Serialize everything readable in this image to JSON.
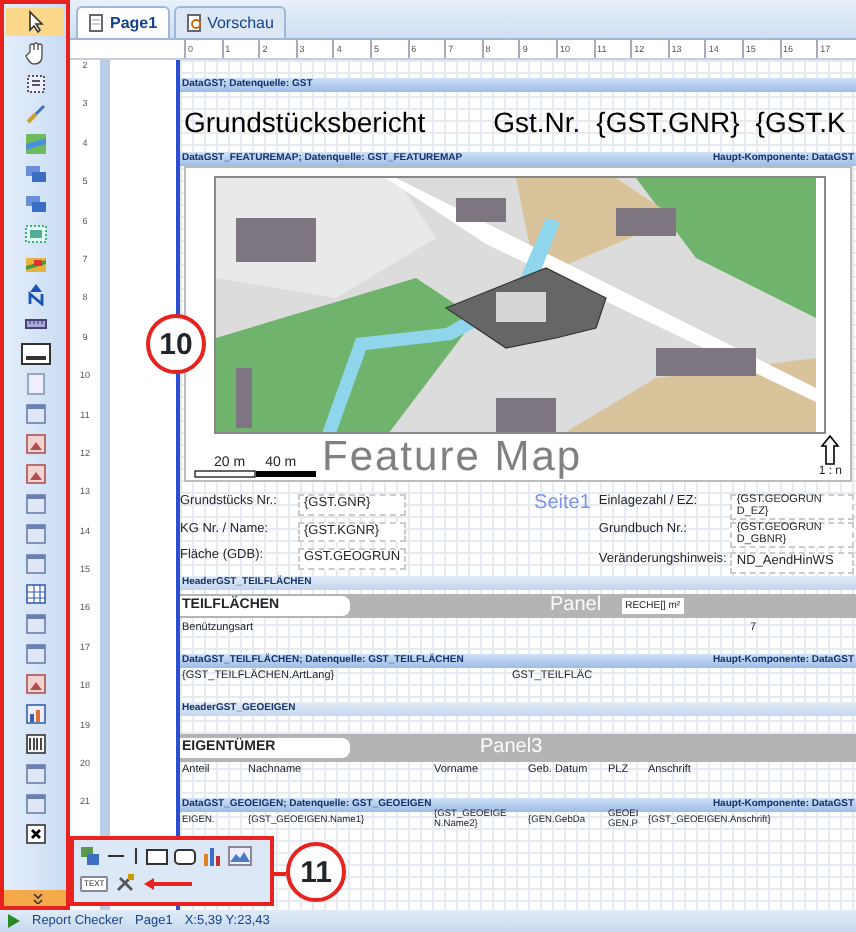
{
  "tabs": [
    {
      "label": "Page1",
      "selected": true
    },
    {
      "label": "Vorschau",
      "selected": false
    }
  ],
  "rulers": {
    "horizontal": [
      "0",
      "1",
      "2",
      "3",
      "4",
      "5",
      "6",
      "7",
      "8",
      "9",
      "10",
      "11",
      "12",
      "13",
      "14",
      "15",
      "16",
      "17"
    ],
    "vertical": [
      "2",
      "3",
      "4",
      "5",
      "6",
      "7",
      "8",
      "9",
      "10",
      "11",
      "12",
      "13",
      "14",
      "15",
      "16",
      "17",
      "18",
      "19",
      "20",
      "21"
    ]
  },
  "report": {
    "title_band": {
      "label": "DataGST; Datenquelle: GST",
      "title": "Grundstücksbericht",
      "fields": [
        "Gst.Nr.",
        "{GST.GNR}",
        "{GST.K"
      ]
    },
    "map_band": {
      "label": "DataGST_FEATUREMAP; Datenquelle: GST_FEATUREMAP",
      "component": "Haupt-Komponente: DataGST",
      "map": {
        "kind": "picture"
      },
      "caption": "Feature Map",
      "scale": [
        "20 m",
        "40 m"
      ],
      "ratio": "1 : n"
    },
    "info": {
      "page_label": "Seite1",
      "left": [
        {
          "label": "Grundstücks Nr.:",
          "value": "{GST.GNR}"
        },
        {
          "label": "KG Nr. / Name:",
          "value": "{GST.KGNR}"
        },
        {
          "label": "Fläche (GDB):",
          "value": "GST.GEOGRUN"
        }
      ],
      "right": [
        {
          "label": "Einlagezahl / EZ:",
          "value": "{GST.GEOGRUN D_EZ}"
        },
        {
          "label": "Grundbuch Nr.:",
          "value": "{GST.GEOGRUN D_GBNR}"
        },
        {
          "label": "Veränderungshinweis:",
          "value": "ND_AendHinWS"
        }
      ]
    },
    "teilflaechen": {
      "header": "HeaderGST_TEILFLÄCHEN",
      "title": "TEILFLÄCHEN",
      "panel": "Panel",
      "area_field": "RECHE[] m²",
      "label_row": [
        "Benützungsart",
        "7"
      ],
      "data_band": "DataGST_TEILFLÄCHEN; Datenquelle: GST_TEILFLÄCHEN",
      "component": "Haupt-Komponente: DataGST",
      "data_row": [
        "{GST_TEILFLÄCHEN.ArtLang}",
        "GST_TEILFLÄC"
      ]
    },
    "eigentuemer": {
      "header": "HeaderGST_GEOEIGEN",
      "title": "EIGENTÜMER",
      "panel": "Panel3",
      "columns": [
        "Anteil",
        "Nachname",
        "Vorname",
        "Geb. Datum",
        "PLZ",
        "Anschrift"
      ],
      "data_band": "DataGST_GEOEIGEN; Datenquelle: GST_GEOEIGEN",
      "component": "Haupt-Komponente: DataGST",
      "data_row": [
        "EIGEN.",
        "{GST_GEOEIGEN.Name1}",
        "{GST_GEOEIGE N.Name2}",
        "{GEN.GebDa",
        "GEOEI GEN.P",
        "{GST_GEOEIGEN.Anschrift}"
      ]
    }
  },
  "toolbox": {
    "text_tool": "TEXT"
  },
  "annotations": [
    {
      "label": "10"
    },
    {
      "label": "11"
    }
  ],
  "status_bar": {
    "checker": "Report Checker",
    "page": "Page1",
    "position": "X:5,39 Y:23,43"
  }
}
